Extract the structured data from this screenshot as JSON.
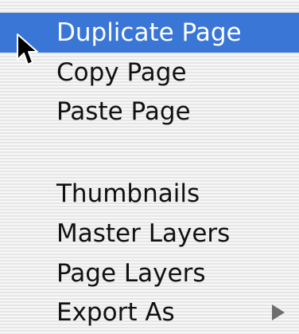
{
  "menu": {
    "items": [
      {
        "label": "Duplicate Page",
        "highlighted": true
      },
      {
        "label": "Copy Page"
      },
      {
        "label": "Paste Page"
      },
      {
        "label": "Thumbnails"
      },
      {
        "label": "Master Layers"
      },
      {
        "label": "Page Layers"
      },
      {
        "label": "Export As",
        "has_submenu": true
      }
    ]
  },
  "colors": {
    "highlight": "#3a76d6",
    "highlight_text": "#ffffff",
    "text": "#111111",
    "submenu_arrow": "#6e6e6e"
  },
  "icons": {
    "cursor": "arrow-pointer-icon",
    "submenu": "triangle-right-icon"
  }
}
